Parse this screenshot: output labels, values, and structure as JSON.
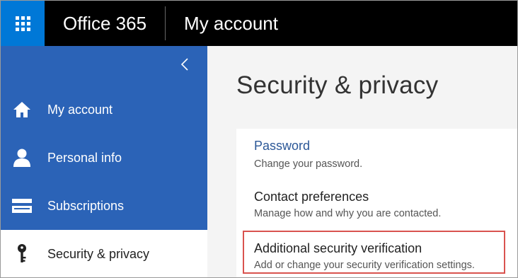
{
  "app": {
    "name": "Office 365",
    "section": "My account"
  },
  "sidebar": {
    "collapse_icon": "chevron-left-icon",
    "items": [
      {
        "label": "My account",
        "icon": "home-icon",
        "active": false
      },
      {
        "label": "Personal info",
        "icon": "person-icon",
        "active": false
      },
      {
        "label": "Subscriptions",
        "icon": "card-icon",
        "active": false
      },
      {
        "label": "Security & privacy",
        "icon": "key-icon",
        "active": true
      }
    ]
  },
  "main": {
    "title": "Security & privacy",
    "options": [
      {
        "title": "Password",
        "description": "Change your password."
      },
      {
        "title": "Contact preferences",
        "description": "Manage how and why you are contacted."
      },
      {
        "title": "Additional security verification",
        "description": "Add or change your security verification settings."
      }
    ]
  },
  "colors": {
    "topbar": "#000000",
    "waffle": "#0078d7",
    "sidebar": "#2b63b7",
    "link": "#2b5797",
    "highlight": "#d9534f"
  }
}
